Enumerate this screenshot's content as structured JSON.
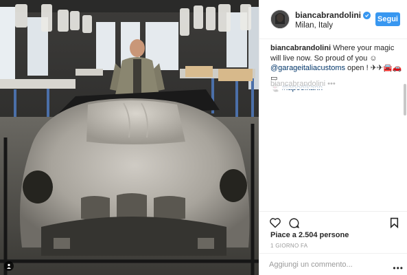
{
  "post": {
    "username": "biancabrandolini",
    "location": "Milan, Italy",
    "follow_label": "Segui",
    "caption_user": "biancabrandolini",
    "caption_text": " Where your magic will live now. So proud of you ☺ ",
    "caption_tag": "@garageitaliacustoms",
    "caption_text2": " open ! ✈✈🚘🚗▭",
    "caption_line3_icon": "👻",
    "caption_hashtag": "#lapoelkann",
    "faded_text": "biancabrandolini •••",
    "likes": "Piace a 2.504 persone",
    "time": "1 GIORNO FA",
    "comment_placeholder": "Aggiungi un commento..."
  },
  "colors": {
    "accent": "#3897f0",
    "text": "#262626",
    "muted": "#999999"
  },
  "icons": [
    "verified-badge-icon",
    "heart-icon",
    "comment-icon",
    "bookmark-icon",
    "more-dots-icon",
    "user-tag-icon"
  ]
}
